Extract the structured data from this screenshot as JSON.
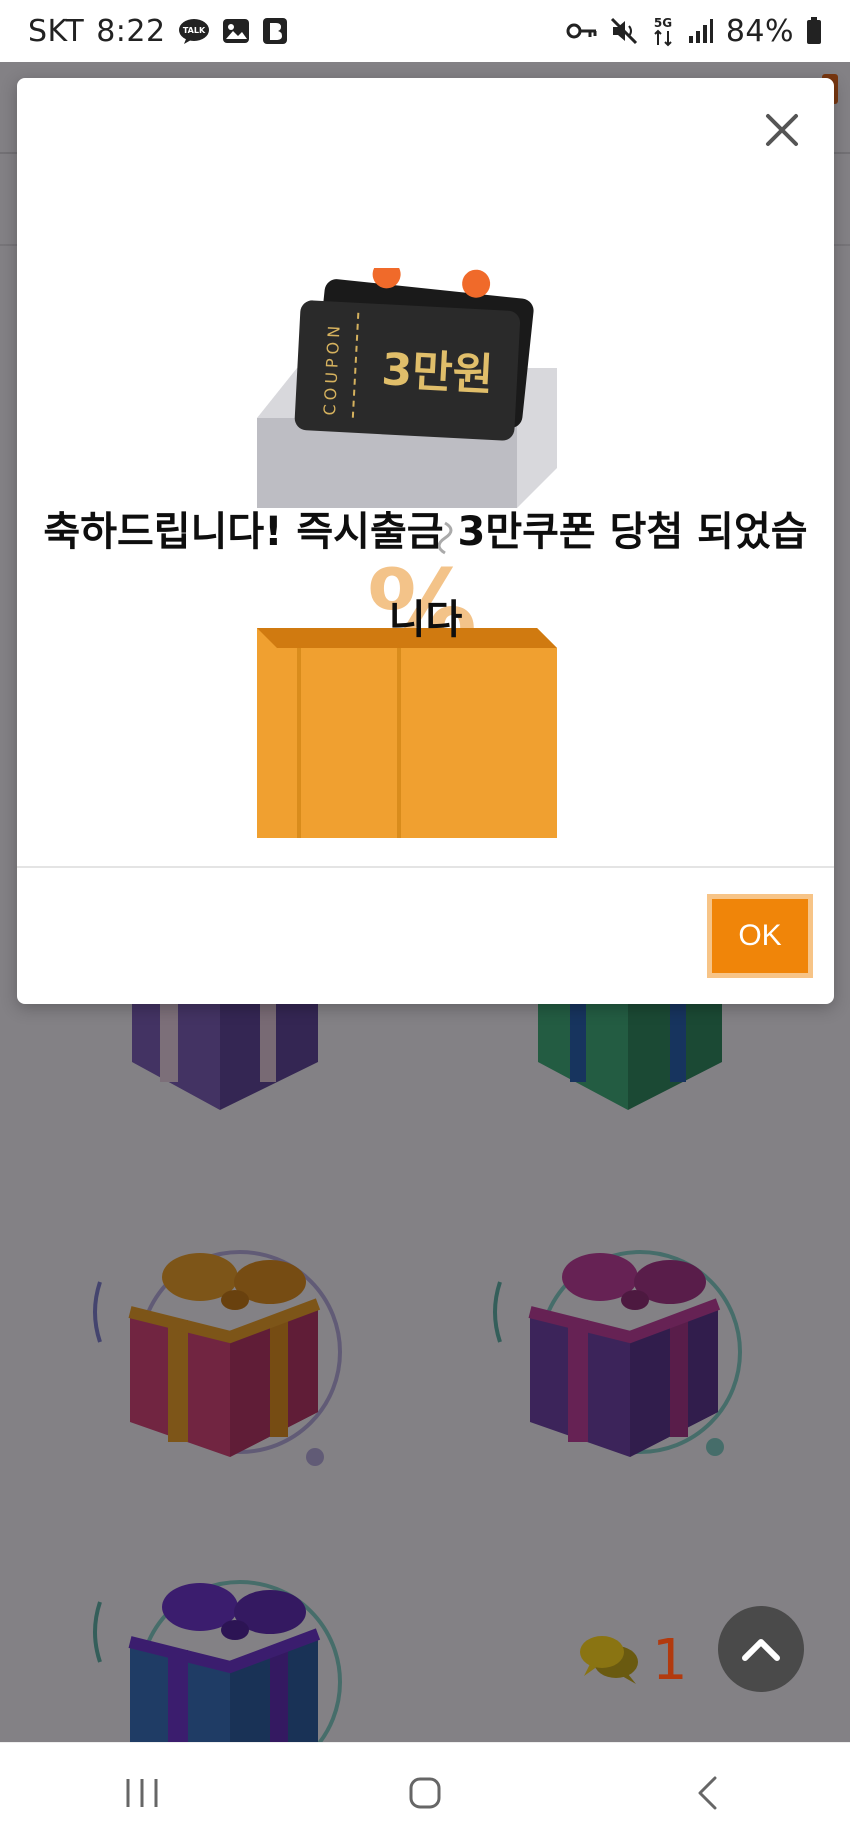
{
  "status_bar": {
    "carrier": "SKT",
    "time": "8:22",
    "battery": "84%",
    "network": "5G",
    "icons": [
      "kakaotalk-icon",
      "gallery-icon",
      "b-app-icon",
      "vpn-key-icon",
      "mute-icon",
      "5g-icon",
      "signal-icon",
      "battery-icon"
    ]
  },
  "modal": {
    "coupon_label": "COUPON",
    "coupon_amount": "3만원",
    "message": "축하드립니다! 즉시출금 3만쿠폰 당첨 되었습니다",
    "ok_label": "OK",
    "close_icon": "close-icon"
  },
  "chat": {
    "count": "1",
    "icon": "chat-bubbles-icon"
  },
  "colors": {
    "ok_button": "#f08509",
    "ok_border": "#f7c487",
    "chat_count": "#b23a0e",
    "overlay": "rgba(18,14,22,0.52)"
  },
  "gifts": [
    {
      "name": "purple-gift-top-left",
      "box": "#6b4fa6",
      "ribbon": "#f1d9e6"
    },
    {
      "name": "green-gift-top-right",
      "box": "#2e9a63",
      "ribbon": "#1e5fae"
    },
    {
      "name": "pink-gift",
      "box": "#d93f72",
      "ribbon": "#f3a31c"
    },
    {
      "name": "violet-gift",
      "box": "#6c3ea6",
      "ribbon": "#c23a9a"
    },
    {
      "name": "blue-gift",
      "box": "#2f6fbd",
      "ribbon": "#6a2fd0"
    }
  ],
  "nav": {
    "recents_icon": "recents-icon",
    "home_icon": "home-icon",
    "back_icon": "back-icon"
  }
}
